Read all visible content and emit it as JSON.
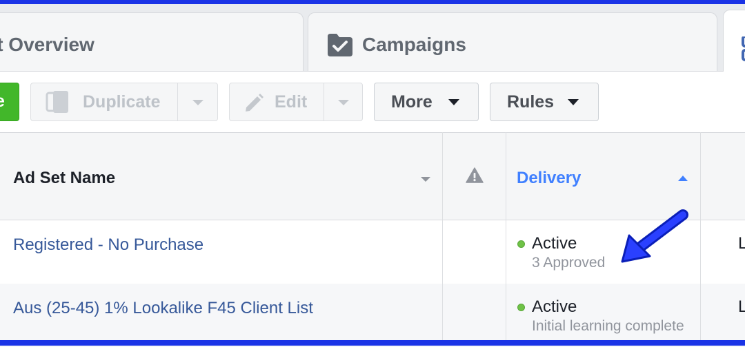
{
  "tabs": [
    {
      "label": "unt Overview",
      "icon": "account-icon"
    },
    {
      "label": "Campaigns",
      "icon": "folder-check-icon"
    },
    {
      "label": "",
      "icon": "grid-icon"
    }
  ],
  "toolbar": {
    "create_partial": "e",
    "duplicate_label": "Duplicate",
    "edit_label": "Edit",
    "more_label": "More",
    "rules_label": "Rules"
  },
  "table": {
    "headers": {
      "name": "Ad Set Name",
      "warning_icon": "warning-icon",
      "delivery": "Delivery"
    },
    "rows": [
      {
        "name": "Registered - No Purchase",
        "status": "Active",
        "detail": "3 Approved",
        "next_col": "L"
      },
      {
        "name": "Aus (25-45) 1% Lookalike F45 Client List",
        "status": "Active",
        "detail": "Initial learning complete",
        "next_col": "L"
      }
    ]
  },
  "colors": {
    "frame": "#1a33e6",
    "link": "#365899",
    "delivery_header": "#4080ff",
    "active_dot": "#6fc247",
    "create_button": "#42b72a",
    "annotation_arrow": "#1a2fe0"
  }
}
